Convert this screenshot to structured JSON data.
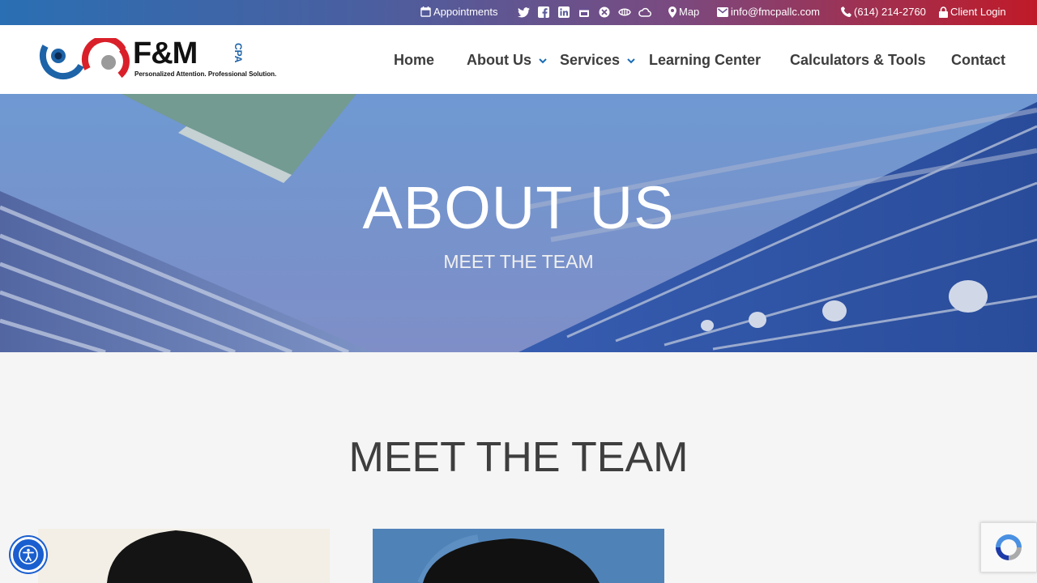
{
  "topbar": {
    "appointments": "Appointments",
    "map": "Map",
    "email": "info@fmcpallc.com",
    "phone": "(614) 214-2760",
    "client_login": "Client Login",
    "social_icons": [
      "twitter-icon",
      "facebook-icon",
      "linkedin-icon",
      "google-business-icon",
      "yelp-icon",
      "manta-icon",
      "cloud-icon"
    ]
  },
  "logo": {
    "brand": "F&M",
    "brand_suffix": "CPA",
    "tagline": "Personalized Attention. Professional Solution."
  },
  "nav": {
    "home": "Home",
    "about": "About Us",
    "services": "Services",
    "learning": "Learning Center",
    "calculators": "Calculators & Tools",
    "contact": "Contact"
  },
  "hero": {
    "title": "ABOUT US",
    "subtitle": "MEET THE TEAM"
  },
  "section": {
    "title": "MEET THE TEAM"
  },
  "colors": {
    "accent": "#1a6db5",
    "brand_red": "#d9202a",
    "brand_blue": "#1d63a8"
  }
}
